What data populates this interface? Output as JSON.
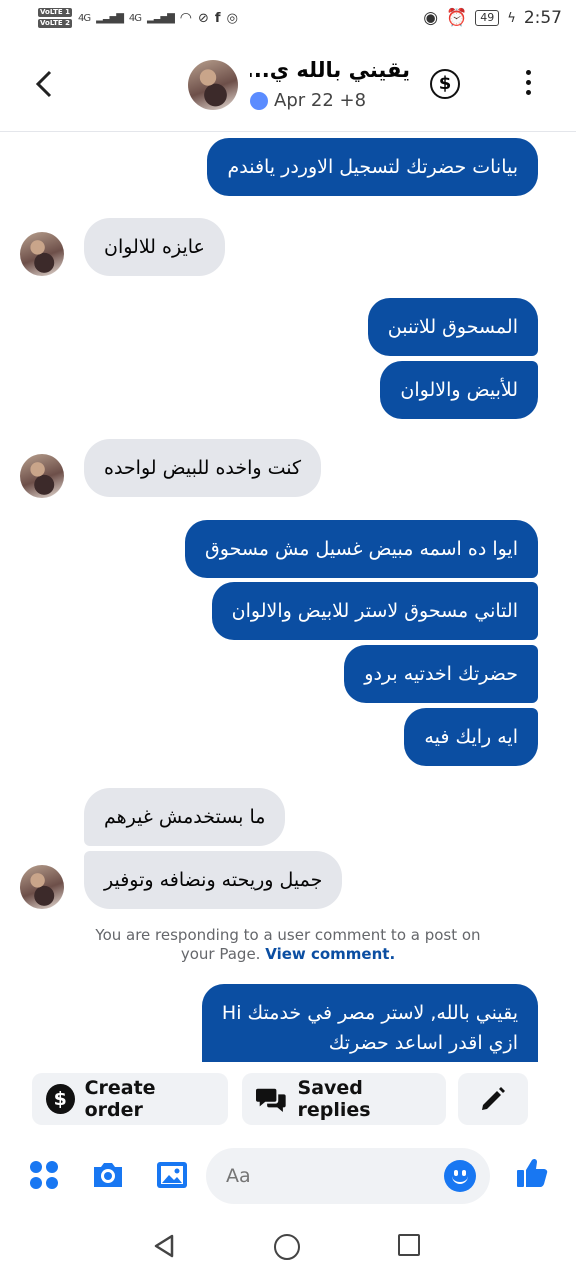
{
  "status_bar": {
    "time": "2:57",
    "battery": "49",
    "sim1": "VoLTE 1",
    "sim2": "VoLTE 2",
    "network1": "4G",
    "network2": "4G"
  },
  "header": {
    "contact_name": "يقيني بالله ي...",
    "subtitle": "Apr 22 +8"
  },
  "messages": [
    {
      "side": "out",
      "text": "بيانات حضرتك لتسجيل الاوردر يافندم"
    },
    {
      "side": "in",
      "text": "عايزه للالوان"
    },
    {
      "side": "out",
      "text": "المسحوق للاتنبن"
    },
    {
      "side": "out",
      "text": "للأبيض والالوان"
    },
    {
      "side": "in",
      "text": "كنت واخده للبيض لواحده"
    },
    {
      "side": "out",
      "text": "ايوا ده اسمه مبيض غسيل مش مسحوق"
    },
    {
      "side": "out",
      "text": "التاني مسحوق لاستر للابيض والالوان"
    },
    {
      "side": "out",
      "text": "حضرتك اخدتيه بردو"
    },
    {
      "side": "out",
      "text": "ايه رايك فيه"
    },
    {
      "side": "in",
      "text": "ما بستخدمش غيرهم"
    },
    {
      "side": "in",
      "text": "جميل وريحته ونضافه وتوفير"
    },
    {
      "side": "out",
      "text_line1": "يقيني بالله, لاستر مصر في خدمتك Hi",
      "text_line2": "ازي اقدر اساعد حضرتك"
    }
  ],
  "notice": {
    "text_line1": "You are responding to a user comment to a post on",
    "text_line2_prefix": "your Page.",
    "link": "View comment."
  },
  "quick_actions": {
    "create_order": "Create order",
    "saved_replies": "Saved replies"
  },
  "composer": {
    "placeholder": "Aa"
  },
  "colors": {
    "outgoing_bubble": "#0b4ea2",
    "incoming_bubble": "#e4e6eb",
    "accent": "#1877f2"
  }
}
